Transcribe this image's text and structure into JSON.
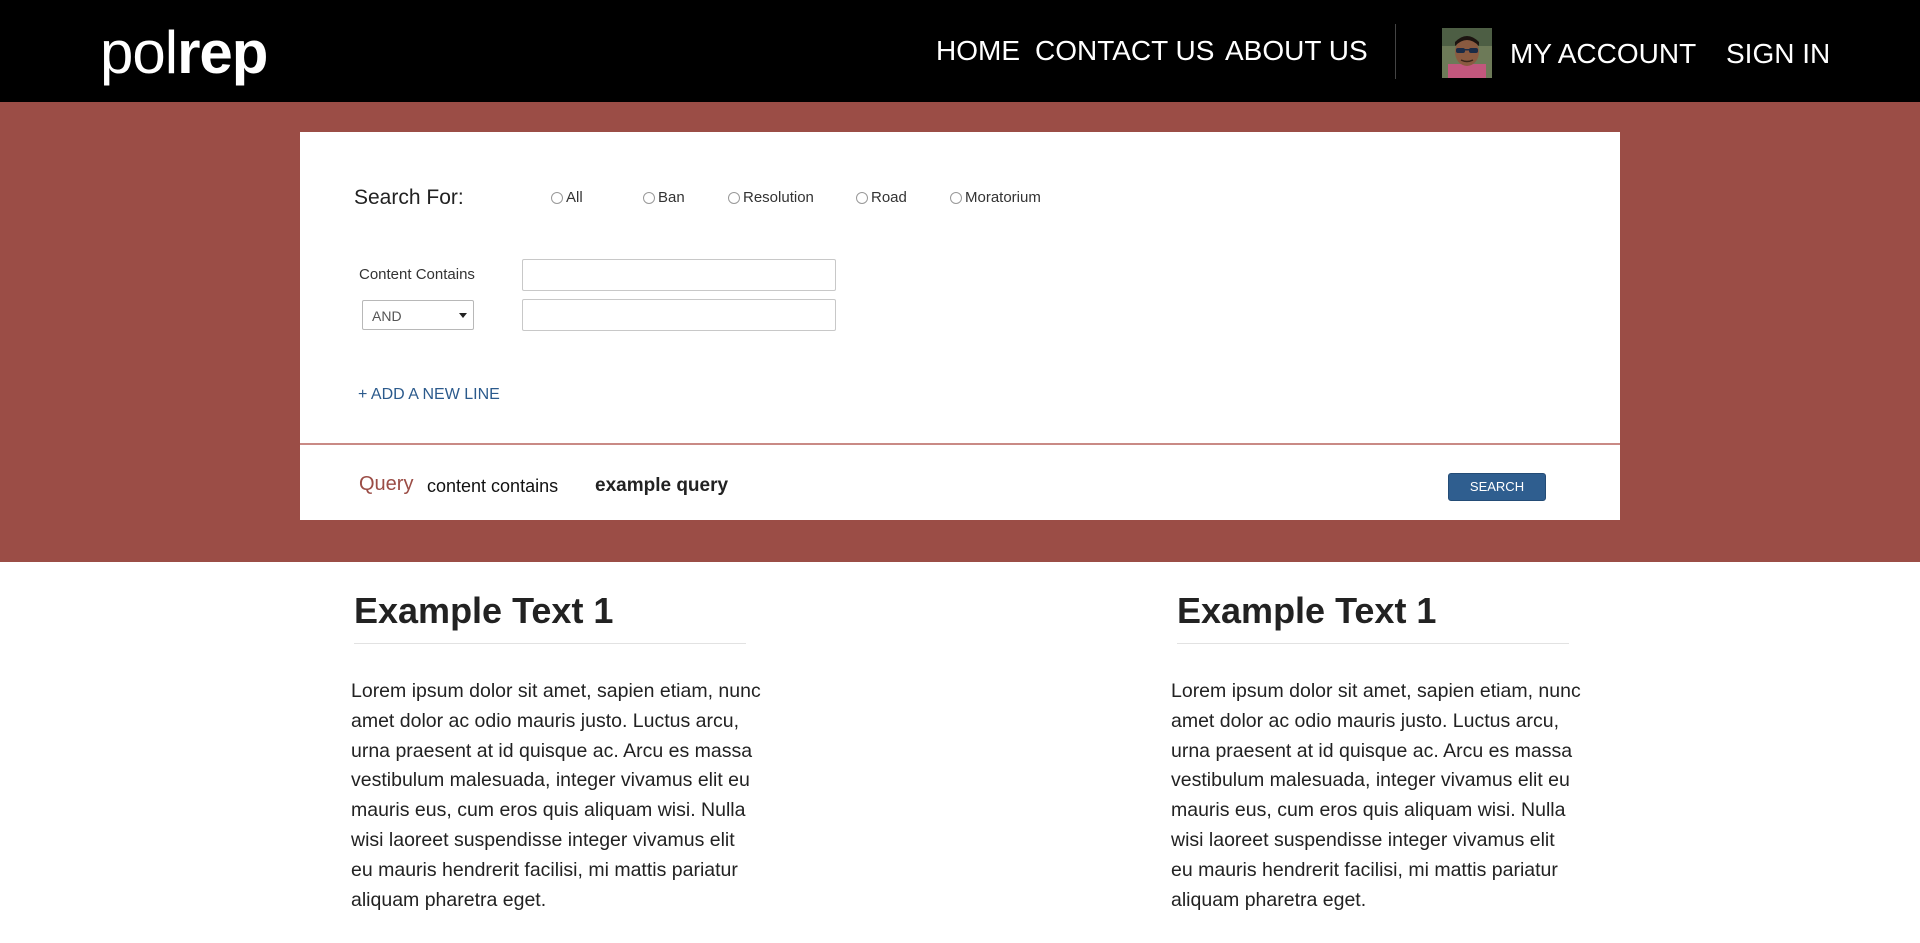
{
  "header": {
    "logo_light": "pol",
    "logo_bold": "rep",
    "nav": {
      "home": "HOME",
      "contact": "CONTACT US",
      "about": "ABOUT US",
      "account": "MY ACCOUNT",
      "signin": "SIGN IN"
    }
  },
  "search": {
    "search_for_label": "Search For:",
    "radios": [
      "All",
      "Ban",
      "Resolution",
      "Road",
      "Moratorium"
    ],
    "content_contains_label": "Content Contains",
    "field1_value": "",
    "operator": "AND",
    "field2_value": "",
    "add_line": "+ ADD A NEW LINE"
  },
  "query": {
    "label": "Query",
    "field": "content contains",
    "value": "example query",
    "search_button": "SEARCH"
  },
  "articles": [
    {
      "title": "Example Text 1",
      "body": "Lorem ipsum dolor sit amet, sapien etiam, nunc amet dolor ac odio mauris justo. Luctus arcu, urna praesent at id quisque ac. Arcu es massa vestibulum malesuada, integer vivamus elit eu mauris eus, cum eros quis aliquam wisi. Nulla wisi laoreet suspendisse integer vivamus elit eu mauris hendrerit facilisi, mi mattis pariatur aliquam pharetra eget."
    },
    {
      "title": "Example Text 1",
      "body": "Lorem ipsum dolor sit amet, sapien etiam, nunc amet dolor ac odio mauris justo. Luctus arcu, urna praesent at id quisque ac. Arcu es massa vestibulum malesuada, integer vivamus elit eu mauris eus, cum eros quis aliquam wisi. Nulla wisi laoreet suspendisse integer vivamus elit eu mauris hendrerit facilisi, mi mattis pariatur aliquam pharetra eget."
    }
  ],
  "colors": {
    "header_bg": "#000000",
    "band_bg": "#9b4d46",
    "link_blue": "#2b5a8c",
    "button_blue": "#2f5e8f",
    "query_label": "#9b4d46"
  }
}
